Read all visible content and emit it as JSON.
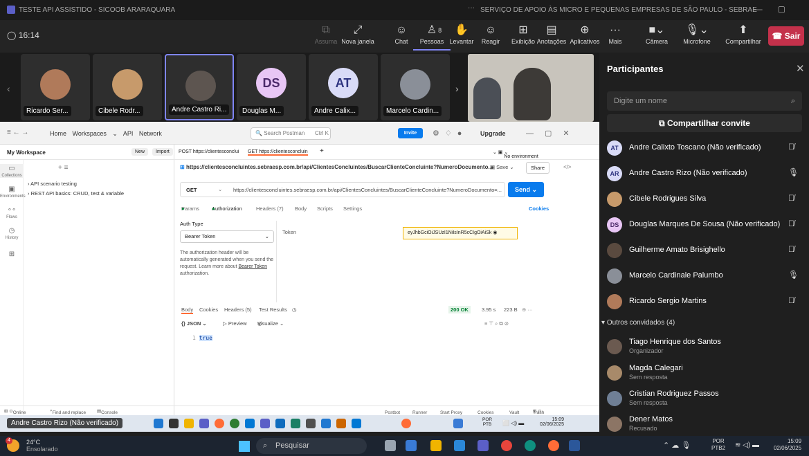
{
  "window": {
    "title": "TESTE API ASSISTIDO - SICOOB ARARAQUARA",
    "org": "SERVIÇO DE APOIO ÀS MICRO E PEQUENAS EMPRESAS DE SÃO PAULO - SEBRAE"
  },
  "meeting": {
    "timer": "16:14",
    "toolbar": [
      {
        "label": "Assuma",
        "icon": "cast-icon"
      },
      {
        "label": "Nova janela",
        "icon": "popout-icon"
      },
      {
        "label": "Chat",
        "icon": "chat-icon"
      },
      {
        "label": "Pessoas",
        "icon": "people-icon",
        "badge": "8"
      },
      {
        "label": "Levantar",
        "icon": "hand-icon"
      },
      {
        "label": "Reagir",
        "icon": "emoji-icon"
      },
      {
        "label": "Exibição",
        "icon": "grid-icon"
      },
      {
        "label": "Anotações",
        "icon": "notes-icon"
      },
      {
        "label": "Aplicativos",
        "icon": "apps-icon"
      },
      {
        "label": "Mais",
        "icon": "more-icon"
      },
      {
        "label": "Câmera",
        "icon": "camera-icon"
      },
      {
        "label": "Microfone",
        "icon": "mic-icon"
      },
      {
        "label": "Compartilhar",
        "icon": "share-icon"
      }
    ],
    "leave": "Sair"
  },
  "tiles": [
    {
      "name": "Ricardo Ser...",
      "initials": ""
    },
    {
      "name": "Cibele Rodr...",
      "initials": ""
    },
    {
      "name": "Andre Castro Ri...",
      "initials": ""
    },
    {
      "name": "Douglas M...",
      "initials": "DS",
      "color": "#e8c6f5",
      "text": "#4b2a6a"
    },
    {
      "name": "Andre Calix...",
      "initials": "AT",
      "color": "#d9dbf7",
      "text": "#2f3580"
    },
    {
      "name": "Marcelo Cardin...",
      "initials": ""
    }
  ],
  "postman": {
    "nav": "Home   Workspaces ⌄   API Network",
    "search": "Search Postman",
    "search_key": "Ctrl K",
    "invite": "Invite",
    "upgrade": "Upgrade",
    "workspace": "My Workspace",
    "ws_new": "New",
    "ws_import": "Import",
    "rail": [
      "Collections",
      "Environments",
      "Flows",
      "History"
    ],
    "collections": [
      "API scenario testing",
      "REST API basics: CRUD, test & variable"
    ],
    "tab1": "POST https://clientesconclui",
    "tab2": "GET https://clientesconcluin",
    "env": "No environment",
    "url_title": "https://clientesconcluintes.sebraesp.com.br/api/ClientesConcluintes/BuscarClienteConcluinte?NumeroDocumento...",
    "save": "Save",
    "share": "Share",
    "method": "GET",
    "url": "https://clientesconcluintes.sebraesp.com.br/api/ClientesConcluintes/BuscarClienteConcluinte?NumeroDocumento=...",
    "send": "Send",
    "req_tabs": [
      "Params",
      "Authorization",
      "Headers (7)",
      "Body",
      "Scripts",
      "Settings"
    ],
    "cookies": "Cookies",
    "auth_type_label": "Auth Type",
    "auth_type": "Bearer Token",
    "auth_desc": "The authorization header will be automatically generated when you send the request. Learn more about",
    "auth_link": "Bearer Token",
    "auth_tail": "authorization.",
    "token_label": "Token",
    "token_value": "eyJhbGciOiJSUzI1NiIsInR5cCIgOiAiSk",
    "res_tabs": [
      "Body",
      "Cookies",
      "Headers (5)",
      "Test Results"
    ],
    "status": "200 OK",
    "time": "3.95 s",
    "size": "223 B",
    "format": "{} JSON ⌄",
    "preview": "▷ Preview",
    "visualize": "Visualize ⌄",
    "line_no": "1",
    "body": "true",
    "statusbar_left": [
      "Online",
      "Find and replace",
      "Console"
    ],
    "statusbar_right": [
      "Postbot",
      "Runner",
      "Start Proxy",
      "Cookies",
      "Vault",
      "Trash"
    ],
    "inner_lang": "POR\nPTB",
    "inner_time": "15:09",
    "inner_date": "02/06/2025"
  },
  "speaker_label": "Andre Castro Rizo (Não verificado)",
  "panel": {
    "title": "Participantes",
    "search": "Digite um nome",
    "invite": "Compartilhar convite",
    "participants": [
      {
        "name": "Andre Calixto Toscano (Não verificado)",
        "initials": "AT",
        "color": "#d9dbf7",
        "text": "#2f3580",
        "muted": true
      },
      {
        "name": "Andre Castro Rizo (Não verificado)",
        "initials": "AR",
        "color": "#d9dbf7",
        "text": "#2f3580",
        "muted": false
      },
      {
        "name": "Cibele Rodrigues Silva",
        "initials": "",
        "color": "#c79a6b",
        "muted": true
      },
      {
        "name": "Douglas Marques De Sousa (Não verificado)",
        "initials": "DS",
        "color": "#e8c6f5",
        "text": "#4b2a6a",
        "muted": true
      },
      {
        "name": "Guilherme Amato Brisighello",
        "initials": "",
        "color": "#5a4a3f",
        "muted": true
      },
      {
        "name": "Marcelo Cardinale Palumbo",
        "initials": "",
        "color": "#8a8f98",
        "muted": false
      },
      {
        "name": "Ricardo Sergio Martins",
        "initials": "",
        "color": "#b07a5a",
        "muted": true
      }
    ],
    "group": "Outros convidados (4)",
    "others": [
      {
        "name": "Tiago Henrique dos Santos",
        "status": "Organizador",
        "color": "#6b5a50"
      },
      {
        "name": "Magda Calegari",
        "status": "Sem resposta",
        "color": "#a88a6a"
      },
      {
        "name": "Cristian Rodriguez Passos",
        "status": "Sem resposta",
        "color": "#6f7f95"
      },
      {
        "name": "Dener Matos",
        "status": "Recusado",
        "color": "#8c7565"
      }
    ]
  },
  "taskbar": {
    "temp": "24°C",
    "weather": "Ensolarado",
    "weather_badge": "4",
    "search": "Pesquisar",
    "lang1": "POR",
    "lang2": "PTB2",
    "time": "15:09",
    "date": "02/06/2025"
  }
}
